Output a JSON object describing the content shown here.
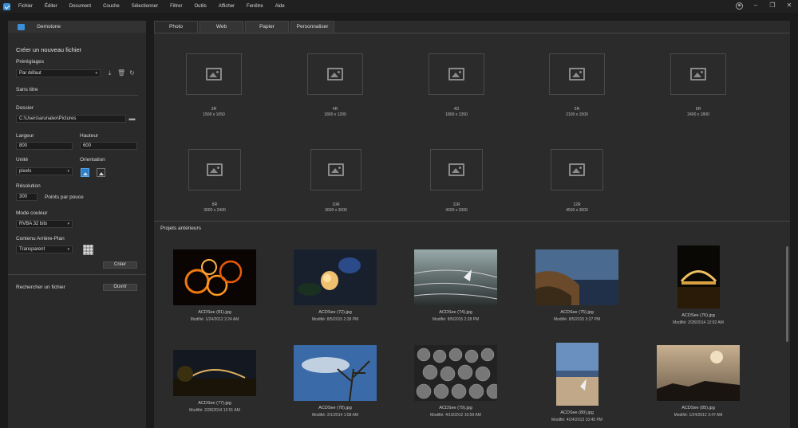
{
  "menu": [
    "Fichier",
    "Éditer",
    "Document",
    "Couche",
    "Sélectionner",
    "Filtrer",
    "Outils",
    "Afficher",
    "Fenêtre",
    "Aide"
  ],
  "left": {
    "app_title": "Gemstone",
    "create_title": "Créer un nouveau fichier",
    "presets_label": "Préréglages",
    "preset_value": "Par défaut",
    "name_value": "Sans titre",
    "folder_label": "Dossier",
    "folder_value": "C:\\Users\\arunalex\\Pictures",
    "width_label": "Largeur",
    "width_value": "800",
    "height_label": "Hauteur",
    "height_value": "600",
    "unit_label": "Unité",
    "unit_value": "pixels",
    "orientation_label": "Orientation",
    "resolution_label": "Résolution",
    "resolution_value": "300",
    "resolution_unit": "Points par pouce",
    "color_mode_label": "Mode couleur",
    "color_mode_value": "RVBA 32 bits",
    "bg_label": "Contenu Arrière-Plan",
    "bg_value": "Transparent",
    "create_button": "Créer",
    "search_label": "Rechercher un fichier",
    "open_button": "Ouvrir"
  },
  "tabs": [
    "Photo",
    "Web",
    "Papier",
    "Personnaliser"
  ],
  "presets": [
    {
      "name": "3R",
      "size": "1500 x 1050"
    },
    {
      "name": "4R",
      "size": "1800 x 1200"
    },
    {
      "name": "4D",
      "size": "1800 x 1350"
    },
    {
      "name": "5R",
      "size": "2100 x 1500"
    },
    {
      "name": "6R",
      "size": "2400 x 1800"
    },
    {
      "name": "8R",
      "size": "3000 x 2400"
    },
    {
      "name": "10R",
      "size": "3600 x 3000"
    },
    {
      "name": "11R",
      "size": "4200 x 3300"
    },
    {
      "name": "12R",
      "size": "4500 x 3600"
    }
  ],
  "recent_title": "Projets antérieurs",
  "recent": [
    {
      "name": "ACDSee (81).jpg",
      "date": "Modifié: 1/24/2012 2:24 AM"
    },
    {
      "name": "ACDSee (72).jpg",
      "date": "Modifié: 8/5/2015 2:28 PM"
    },
    {
      "name": "ACDSee (74).jpg",
      "date": "Modifié: 8/5/2015 2:28 PM"
    },
    {
      "name": "ACDSee (75).jpg",
      "date": "Modifié: 8/5/2015 3:27 PM"
    },
    {
      "name": "ACDSee (76).jpg",
      "date": "Modifié: 2/28/2014 12:02 AM"
    },
    {
      "name": "ACDSee (77).jpg",
      "date": "Modifié: 2/28/2014 12:51 AM"
    },
    {
      "name": "ACDSee (78).jpg",
      "date": "Modifié: 2/1/2014 1:58 AM"
    },
    {
      "name": "ACDSee (79).jpg",
      "date": "Modifié: 4/19/2012 10:59 AM"
    },
    {
      "name": "ACDSee (80).jpg",
      "date": "Modifié: 4/24/2013 10:45 PM"
    },
    {
      "name": "ACDSee (85).jpg",
      "date": "Modifié: 1/24/2012 3:47 AM"
    }
  ]
}
